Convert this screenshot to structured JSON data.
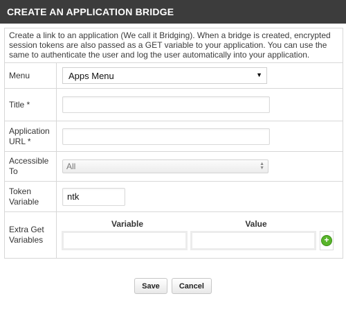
{
  "header": {
    "title": "CREATE AN APPLICATION BRIDGE"
  },
  "intro": "Create a link to an application (We call it Bridging). When a bridge is created, encrypted session tokens are also passed as a GET variable to your application. You can use the same to authenticate the user and log the user automatically into your application.",
  "form": {
    "menu": {
      "label": "Menu",
      "value": "Apps Menu"
    },
    "title": {
      "label": "Title *",
      "value": ""
    },
    "app_url": {
      "label": "Application URL *",
      "value": ""
    },
    "accessible_to": {
      "label": "Accessible To",
      "value": "All"
    },
    "token_variable": {
      "label": "Token Variable",
      "value": "ntk"
    },
    "extra_get": {
      "label": "Extra Get Variables",
      "variable_header": "Variable",
      "value_header": "Value"
    }
  },
  "buttons": {
    "save": "Save",
    "cancel": "Cancel"
  },
  "colors": {
    "header_bg": "#3c3c3c",
    "add_icon": "#58b52a"
  }
}
